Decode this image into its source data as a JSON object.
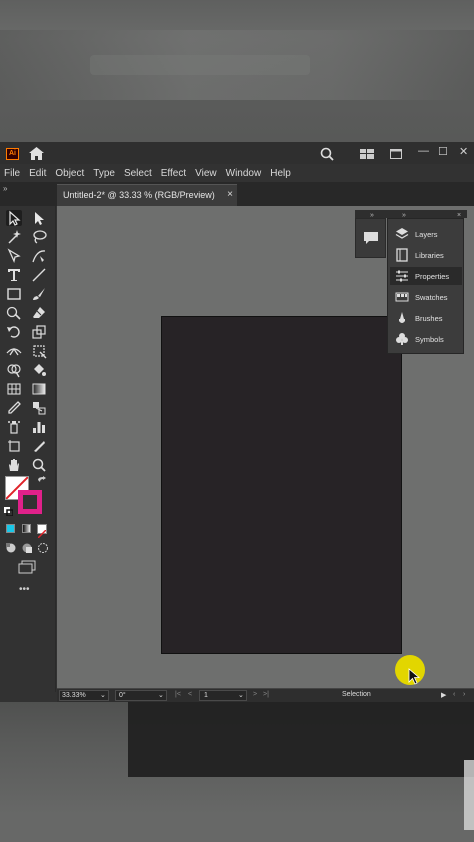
{
  "app": {
    "logo": "Ai",
    "window_controls": {
      "minimize": "—",
      "restore": "☐",
      "close": "✕"
    }
  },
  "menu": [
    "File",
    "Edit",
    "Object",
    "Type",
    "Select",
    "Effect",
    "View",
    "Window",
    "Help"
  ],
  "document_tab": {
    "title": "Untitled-2* @ 33.33 % (RGB/Preview)",
    "close": "×"
  },
  "panel": {
    "collapse_label": "»",
    "items": [
      {
        "label": "Layers",
        "icon": "layers-icon",
        "active": false
      },
      {
        "label": "Libraries",
        "icon": "libraries-icon",
        "active": false
      },
      {
        "label": "Properties",
        "icon": "properties-icon",
        "active": true
      },
      {
        "label": "Swatches",
        "icon": "swatches-icon",
        "active": false
      },
      {
        "label": "Brushes",
        "icon": "brushes-icon",
        "active": false
      },
      {
        "label": "Symbols",
        "icon": "symbols-icon",
        "active": false
      }
    ]
  },
  "status": {
    "zoom": "33.33%",
    "rotation": "0°",
    "artboard_number": "1",
    "tool": "Selection"
  },
  "colors": {
    "artboard": "#272326",
    "canvas": "#6e6f6e",
    "stroke_swatch": "#e0218a",
    "cursor_highlight": "#e2d600"
  },
  "toolbar": {
    "more_tools": "•••"
  }
}
